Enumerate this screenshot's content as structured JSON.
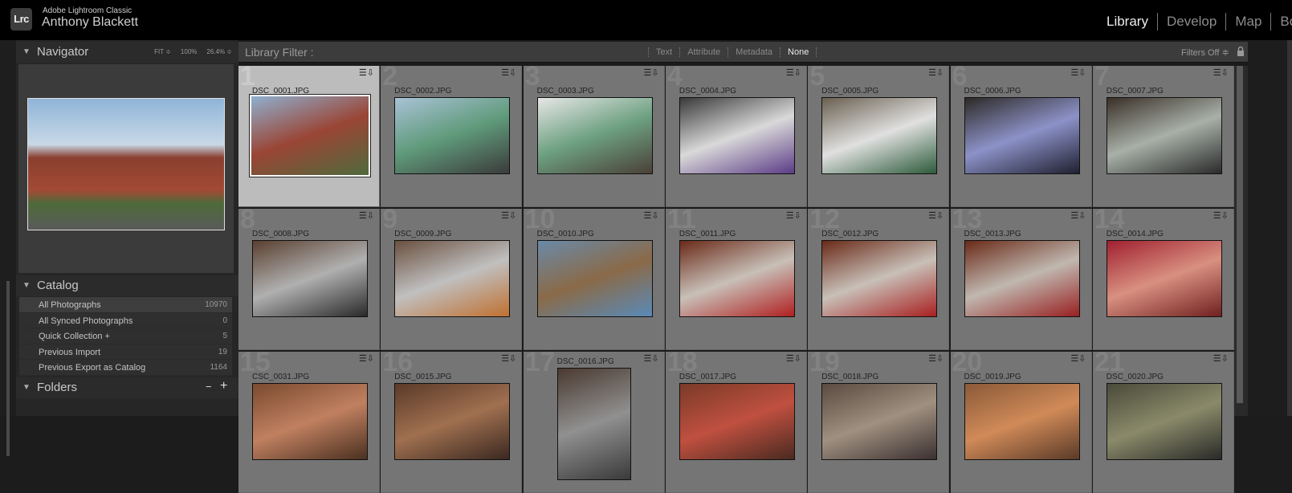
{
  "topbar": {
    "logo": "Lrc",
    "app_name": "Adobe Lightroom Classic",
    "user_name": "Anthony Blackett",
    "modules": [
      "Library",
      "Develop",
      "Map",
      "Bo"
    ]
  },
  "navigator": {
    "title": "Navigator",
    "zoom_options": [
      "FIT ≑",
      "100%",
      "26.4% ≑"
    ]
  },
  "catalog": {
    "title": "Catalog",
    "items": [
      {
        "label": "All Photographs",
        "count": "10970"
      },
      {
        "label": "All Synced Photographs",
        "count": "0"
      },
      {
        "label": "Quick Collection +",
        "count": "5"
      },
      {
        "label": "Previous Import",
        "count": "19"
      },
      {
        "label": "Previous Export as Catalog",
        "count": "1164"
      }
    ]
  },
  "folders": {
    "title": "Folders",
    "minus": "−",
    "plus": "+"
  },
  "filterbar": {
    "label": "Library Filter :",
    "tabs": [
      "Text",
      "Attribute",
      "Metadata",
      "None"
    ],
    "active_tab": "None",
    "filters_off": "Filters Off ≑"
  },
  "grid": {
    "cells": [
      {
        "num": "1",
        "file": "DSC_0001.JPG",
        "colors": [
          "#8fb0d0",
          "#9a4535",
          "#4f6a3c"
        ],
        "selected": true
      },
      {
        "num": "2",
        "file": "DSC_0002.JPG",
        "colors": [
          "#a9c2d6",
          "#5f9a7a",
          "#3b3b3b"
        ]
      },
      {
        "num": "3",
        "file": "DSC_0003.JPG",
        "colors": [
          "#e6e6e6",
          "#6da080",
          "#4a4038"
        ]
      },
      {
        "num": "4",
        "file": "DSC_0004.JPG",
        "colors": [
          "#3a3a3a",
          "#d9d9d9",
          "#5b3b86"
        ]
      },
      {
        "num": "5",
        "file": "DSC_0005.JPG",
        "colors": [
          "#6a6050",
          "#e0e0e0",
          "#2d5a3a"
        ]
      },
      {
        "num": "6",
        "file": "DSC_0006.JPG",
        "colors": [
          "#2e2a28",
          "#8c92c8",
          "#1f2030"
        ]
      },
      {
        "num": "7",
        "file": "DSC_0007.JPG",
        "colors": [
          "#3a3028",
          "#a8b0a8",
          "#2a2a2a"
        ]
      },
      {
        "num": "8",
        "file": "DSC_0008.JPG",
        "colors": [
          "#5a4030",
          "#b0b0b0",
          "#2a2a2a"
        ]
      },
      {
        "num": "9",
        "file": "DSC_0009.JPG",
        "colors": [
          "#6a5040",
          "#c0c0c0",
          "#c07030"
        ]
      },
      {
        "num": "10",
        "file": "DSC_0010.JPG",
        "colors": [
          "#6a8aa8",
          "#8a6a48",
          "#5a8ab8"
        ]
      },
      {
        "num": "11",
        "file": "DSC_0011.JPG",
        "colors": [
          "#6a2a18",
          "#c8c0b8",
          "#b02020"
        ]
      },
      {
        "num": "12",
        "file": "DSC_0012.JPG",
        "colors": [
          "#6a2a18",
          "#c8c0b8",
          "#a82020"
        ]
      },
      {
        "num": "13",
        "file": "DSC_0013.JPG",
        "colors": [
          "#6a2a18",
          "#c0b8b0",
          "#982020"
        ]
      },
      {
        "num": "14",
        "file": "DSC_0014.JPG",
        "colors": [
          "#a02030",
          "#d89080",
          "#702020"
        ]
      },
      {
        "num": "15",
        "file": "CSC_0031.JPG",
        "colors": [
          "#7a4a30",
          "#c08060",
          "#4a3020"
        ]
      },
      {
        "num": "16",
        "file": "DSC_0015.JPG",
        "colors": [
          "#5a3a28",
          "#a07050",
          "#3a2820"
        ]
      },
      {
        "num": "17",
        "file": "DSC_0016.JPG",
        "colors": [
          "#4a3a30",
          "#909090",
          "#3a3a3a"
        ],
        "portrait": true
      },
      {
        "num": "18",
        "file": "DSC_0017.JPG",
        "colors": [
          "#7a3a28",
          "#c05040",
          "#4a2a20"
        ]
      },
      {
        "num": "19",
        "file": "DSC_0018.JPG",
        "colors": [
          "#5a4a40",
          "#a09080",
          "#3a3030"
        ]
      },
      {
        "num": "20",
        "file": "DSC_0019.JPG",
        "colors": [
          "#8a5a38",
          "#d08a58",
          "#5a3a28"
        ]
      },
      {
        "num": "21",
        "file": "DSC_0020.JPG",
        "colors": [
          "#4a4a3a",
          "#8a8a6a",
          "#2a2a28"
        ]
      }
    ]
  }
}
